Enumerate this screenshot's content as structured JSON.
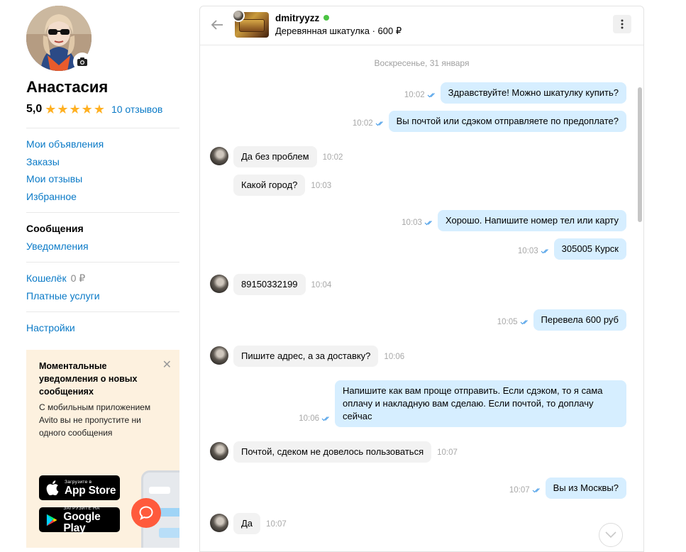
{
  "profile": {
    "name": "Анастасия",
    "rating": "5,0",
    "stars": 5,
    "reviews_link": "10 отзывов"
  },
  "nav": {
    "group1": [
      "Мои объявления",
      "Заказы",
      "Мои отзывы",
      "Избранное"
    ],
    "messages": "Сообщения",
    "notifications": "Уведомления",
    "wallet": "Кошелёк",
    "wallet_balance": "0 ₽",
    "paid_services": "Платные услуги",
    "settings": "Настройки"
  },
  "promo": {
    "title": "Моментальные уведомления о новых сообщениях",
    "text": "С мобильным приложением Avito вы не пропустите ни одного сообщения",
    "appstore_small": "Загрузите в",
    "appstore_big": "App Store",
    "googleplay_small": "ЗАГРУЗИТЕ НА",
    "googleplay_big": "Google Play"
  },
  "chat": {
    "seller": "dmitryyzz",
    "item": "Деревянная шкатулка · 600 ₽",
    "date": "Воскресенье, 31 января",
    "messages": [
      {
        "dir": "out",
        "text": "Здравствуйте! Можно шкатулку купить?",
        "time": "10:02"
      },
      {
        "dir": "out",
        "text": "Вы почтой или сдэком отправляете по предоплате?",
        "time": "10:02"
      },
      {
        "dir": "in",
        "text": "Да без проблем",
        "time": "10:02"
      },
      {
        "dir": "in",
        "text": "Какой город?",
        "time": "10:03"
      },
      {
        "dir": "out",
        "text": "Хорошо. Напишите номер тел или карту",
        "time": "10:03"
      },
      {
        "dir": "out",
        "text": "305005 Курск",
        "time": "10:03"
      },
      {
        "dir": "in",
        "text": "89150332199",
        "time": "10:04"
      },
      {
        "dir": "out",
        "text": "Перевела 600 руб",
        "time": "10:05"
      },
      {
        "dir": "in",
        "text": "Пишите адрес, а за доставку?",
        "time": "10:06"
      },
      {
        "dir": "out",
        "text": "Напишите как вам проще отправить. Если сдэком, то я сама оплачу и накладную вам сделаю. Если почтой, то доплачу сейчас",
        "time": "10:06"
      },
      {
        "dir": "in",
        "text": "Почтой, сдеком не довелось пользоваться",
        "time": "10:07"
      },
      {
        "dir": "out",
        "text": "Вы из Москвы?",
        "time": "10:07"
      },
      {
        "dir": "in",
        "text": "Да",
        "time": "10:07"
      }
    ]
  },
  "colors": {
    "link": "#0a7ac7",
    "star": "#ffb021",
    "outgoing_bubble": "#d6eeff",
    "incoming_bubble": "#f2f2f2",
    "online": "#4bc443",
    "promo_bg": "#fdf1df",
    "fab": "#ff5a3c"
  }
}
